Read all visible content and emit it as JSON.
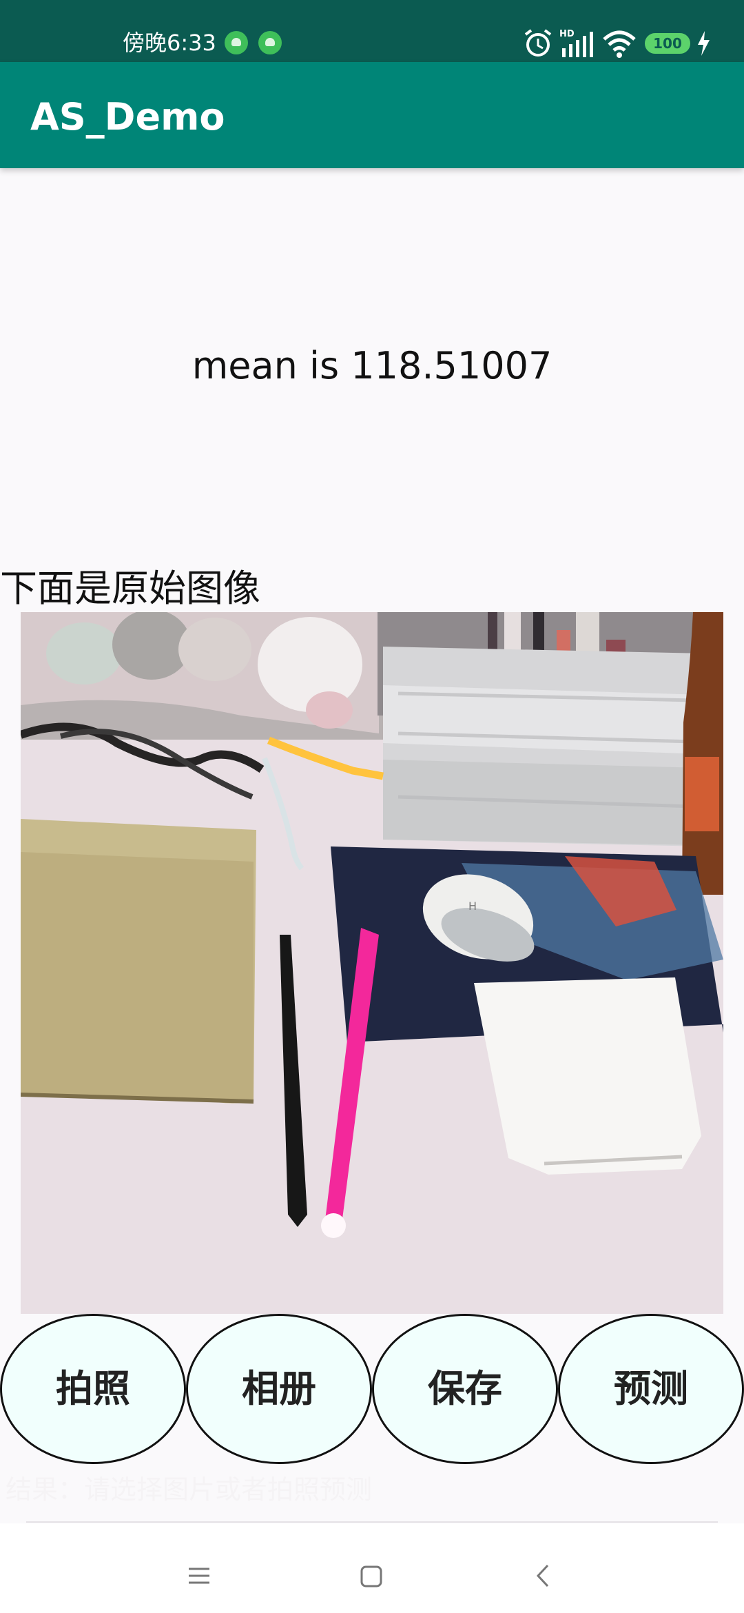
{
  "status_bar": {
    "time": "傍晚6:33",
    "battery_level": "100",
    "icons": [
      "android-app-icon",
      "android-app-icon",
      "alarm-icon",
      "hd-signal-icon",
      "wifi-icon",
      "battery-icon",
      "charging-icon"
    ]
  },
  "app_bar": {
    "title": "AS_Demo",
    "background_color": "#008577"
  },
  "content": {
    "mean_text": "mean is 118.51007",
    "original_image_label": "下面是原始图像",
    "original_image": "desk photo: laptop, pens, mouse, power bank"
  },
  "buttons": [
    {
      "label": "拍照"
    },
    {
      "label": "相册"
    },
    {
      "label": "保存"
    },
    {
      "label": "预测"
    }
  ],
  "footer_caption": "结果：请选择图片或者拍照预测",
  "navigation": {
    "icons": [
      "menu-icon",
      "home-icon",
      "back-icon"
    ]
  }
}
